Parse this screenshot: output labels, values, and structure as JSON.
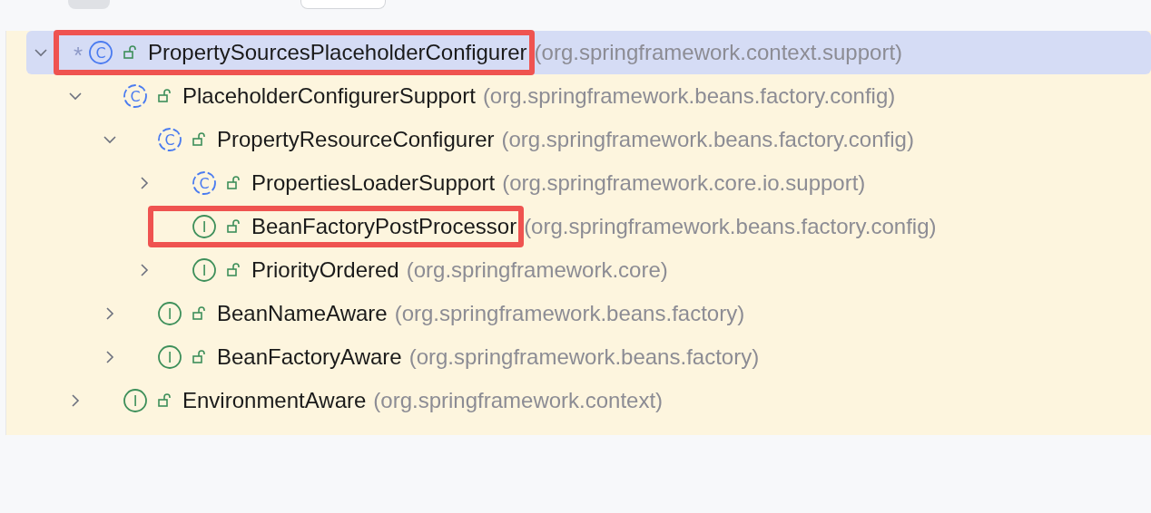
{
  "tree": [
    {
      "marker": "*",
      "badge": "C",
      "name": "PropertySourcesPlaceholderConfigurer",
      "package": "(org.springframework.context.support)",
      "kind": "class",
      "selected": true,
      "highlighted": true,
      "expanded": true,
      "children": [
        {
          "badge": "C",
          "name": "PlaceholderConfigurerSupport",
          "package": "(org.springframework.beans.factory.config)",
          "kind": "abstract",
          "selected": false,
          "highlighted": false,
          "expanded": true,
          "children": [
            {
              "badge": "C",
              "name": "PropertyResourceConfigurer",
              "package": "(org.springframework.beans.factory.config)",
              "kind": "abstract",
              "selected": false,
              "highlighted": false,
              "expanded": true,
              "children": [
                {
                  "badge": "C",
                  "name": "PropertiesLoaderSupport",
                  "package": "(org.springframework.core.io.support)",
                  "kind": "abstract",
                  "selected": false,
                  "highlighted": false,
                  "expanded": false
                },
                {
                  "badge": "I",
                  "name": "BeanFactoryPostProcessor",
                  "package": "(org.springframework.beans.factory.config)",
                  "kind": "interface",
                  "selected": false,
                  "highlighted": true
                },
                {
                  "badge": "I",
                  "name": "PriorityOrdered",
                  "package": "(org.springframework.core)",
                  "kind": "interface",
                  "selected": false,
                  "highlighted": false,
                  "expanded": false
                }
              ]
            },
            {
              "badge": "I",
              "name": "BeanNameAware",
              "package": "(org.springframework.beans.factory)",
              "kind": "interface",
              "selected": false,
              "highlighted": false,
              "expanded": false
            },
            {
              "badge": "I",
              "name": "BeanFactoryAware",
              "package": "(org.springframework.beans.factory)",
              "kind": "interface",
              "selected": false,
              "highlighted": false,
              "expanded": false
            }
          ]
        },
        {
          "badge": "I",
          "name": "EnvironmentAware",
          "package": "(org.springframework.context)",
          "kind": "interface",
          "selected": false,
          "highlighted": false,
          "expanded": false
        }
      ]
    }
  ]
}
